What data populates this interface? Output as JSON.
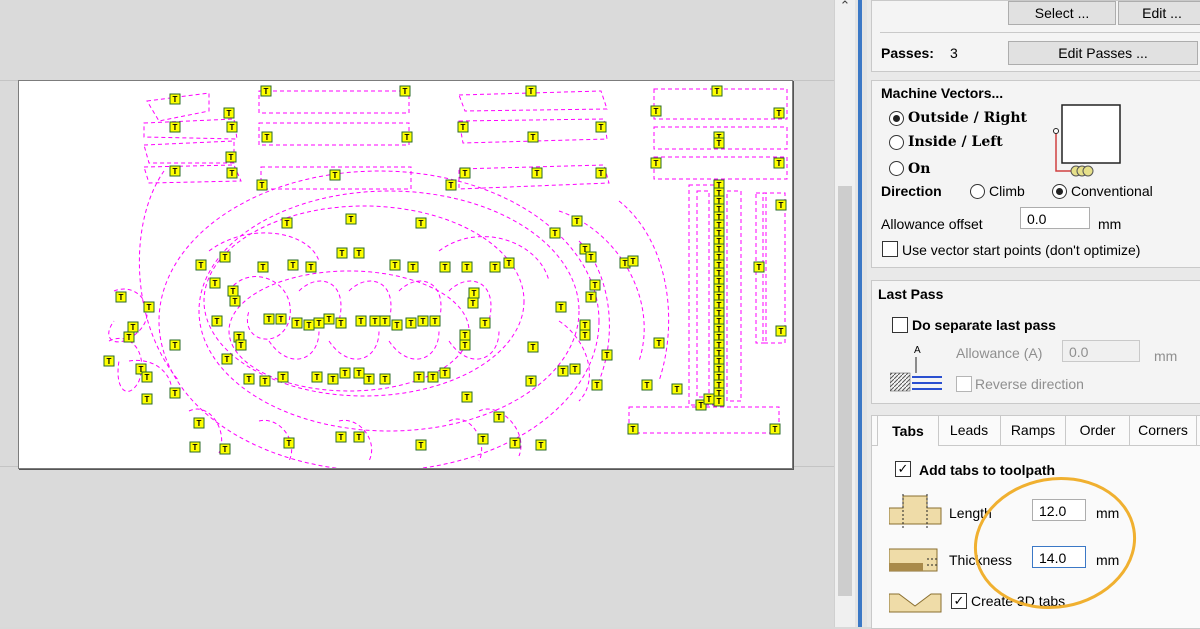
{
  "toolpath_panel": {
    "select_button": "Select ...",
    "edit_button": "Edit ...",
    "passes_label": "Passes:",
    "passes_value": "3",
    "edit_passes_button": "Edit Passes ...",
    "machine_vectors": {
      "title": "Machine Vectors...",
      "options": [
        "Outside / Right",
        "Inside / Left",
        "On"
      ],
      "selected": "Outside / Right",
      "direction_label": "Direction",
      "direction_options": [
        "Climb",
        "Conventional"
      ],
      "direction_selected": "Conventional",
      "allowance_label": "Allowance offset",
      "allowance_value": "0.0",
      "allowance_unit": "mm",
      "use_start_points_label": "Use vector start points (don't optimize)",
      "use_start_points_checked": false
    },
    "last_pass": {
      "title": "Last Pass",
      "separate_label": "Do separate last pass",
      "separate_checked": false,
      "allowance_label": "Allowance (A)",
      "allowance_value": "0.0",
      "allowance_unit": "mm",
      "reverse_label": "Reverse direction",
      "reverse_checked": false,
      "diagram_letter": "A"
    },
    "tabs": [
      "Tabs",
      "Leads",
      "Ramps",
      "Order",
      "Corners"
    ],
    "active_tab": "Tabs",
    "tabs_page": {
      "add_tabs_label": "Add tabs to toolpath",
      "add_tabs_checked": true,
      "length_label": "Length",
      "length_value": "12.0",
      "length_unit": "mm",
      "thickness_label": "Thickness",
      "thickness_value": "14.0",
      "thickness_unit": "mm",
      "create_3d_label": "Create 3D tabs",
      "create_3d_checked": true
    }
  },
  "design_view": {
    "tab_marker_glyph": "T",
    "vector_color": "#ff00ff",
    "tab_marker_color": "#ffff00",
    "annotation_color": "#f0b030"
  }
}
